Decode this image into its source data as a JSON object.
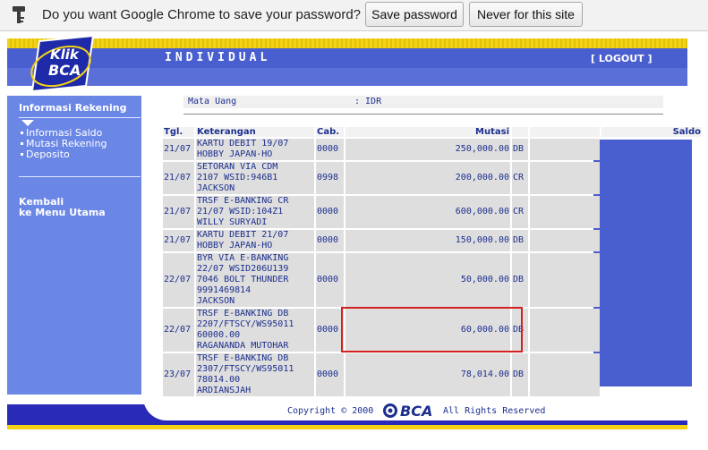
{
  "infobar": {
    "message": "Do you want Google Chrome to save your password?",
    "save_label": "Save password",
    "never_label": "Never for this site"
  },
  "header": {
    "title": "INDIVIDUAL",
    "logout": "[ LOGOUT ]",
    "logo_text_top": "Klik",
    "logo_text_bottom": "BCA"
  },
  "sidebar": {
    "title": "Informasi Rekening",
    "items": [
      "Informasi Saldo",
      "Mutasi Rekening",
      "Deposito"
    ],
    "back_line1": "Kembali",
    "back_line2": "ke Menu Utama"
  },
  "account": {
    "currency_label": "Mata Uang",
    "currency_value": ": IDR"
  },
  "table": {
    "headers": {
      "tgl": "Tgl.",
      "ket": "Keterangan",
      "cab": "Cab.",
      "mutasi": "Mutasi",
      "saldo": "Saldo"
    },
    "rows": [
      {
        "tgl": "21/07",
        "ket": [
          "KARTU DEBIT 19/07",
          "HOBBY JAPAN-HO"
        ],
        "cab": "0000",
        "amount": "250,000.00",
        "type": "DB"
      },
      {
        "tgl": "21/07",
        "ket": [
          "SETORAN VIA CDM",
          "2107 WSID:946B1",
          "JACKSON"
        ],
        "cab": "0998",
        "amount": "200,000.00",
        "type": "CR"
      },
      {
        "tgl": "21/07",
        "ket": [
          "TRSF E-BANKING CR",
          "21/07 WSID:104Z1",
          "WILLY SURYADI"
        ],
        "cab": "0000",
        "amount": "600,000.00",
        "type": "CR"
      },
      {
        "tgl": "21/07",
        "ket": [
          "KARTU DEBIT 21/07",
          "HOBBY JAPAN-HO"
        ],
        "cab": "0000",
        "amount": "150,000.00",
        "type": "DB"
      },
      {
        "tgl": "22/07",
        "ket": [
          "BYR VIA E-BANKING",
          "22/07 WSID206U139",
          "7046 BOLT THUNDER",
          "9991469814",
          "JACKSON"
        ],
        "cab": "0000",
        "amount": "50,000.00",
        "type": "DB"
      },
      {
        "tgl": "22/07",
        "ket": [
          "TRSF E-BANKING DB",
          "2207/FTSCY/WS95011",
          "60000.00",
          "RAGANANDA MUTOHAR"
        ],
        "cab": "0000",
        "amount": "60,000.00",
        "type": "DB"
      },
      {
        "tgl": "23/07",
        "ket": [
          "TRSF E-BANKING DB",
          "2307/FTSCY/WS95011",
          "78014.00",
          "ARDIANSJAH"
        ],
        "cab": "0000",
        "amount": "78,014.00",
        "type": "DB"
      }
    ]
  },
  "footer": {
    "copyright": "Copyright © 2000",
    "brand": "BCA",
    "rights": "All Rights Reserved"
  },
  "colors": {
    "header_blue": "#4a5fcf",
    "sidebar_blue": "#6b87e6",
    "footer_blue": "#2a2ab8",
    "accent_yellow": "#f4d215",
    "text_navy": "#1c2f8e",
    "highlight_red": "#d42020"
  }
}
